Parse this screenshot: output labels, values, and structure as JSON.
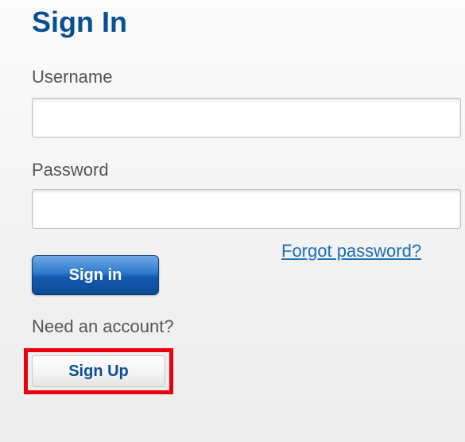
{
  "form": {
    "title": "Sign In",
    "username_label": "Username",
    "username_value": "",
    "password_label": "Password",
    "password_value": "",
    "forgot_password_link": "Forgot password?",
    "signin_button": "Sign in",
    "need_account_text": "Need an account?",
    "signup_button": "Sign Up"
  },
  "colors": {
    "title": "#0a4f92",
    "link": "#1b6eb8",
    "primary_button": "#145bb0",
    "highlight_border": "#e8000d"
  }
}
